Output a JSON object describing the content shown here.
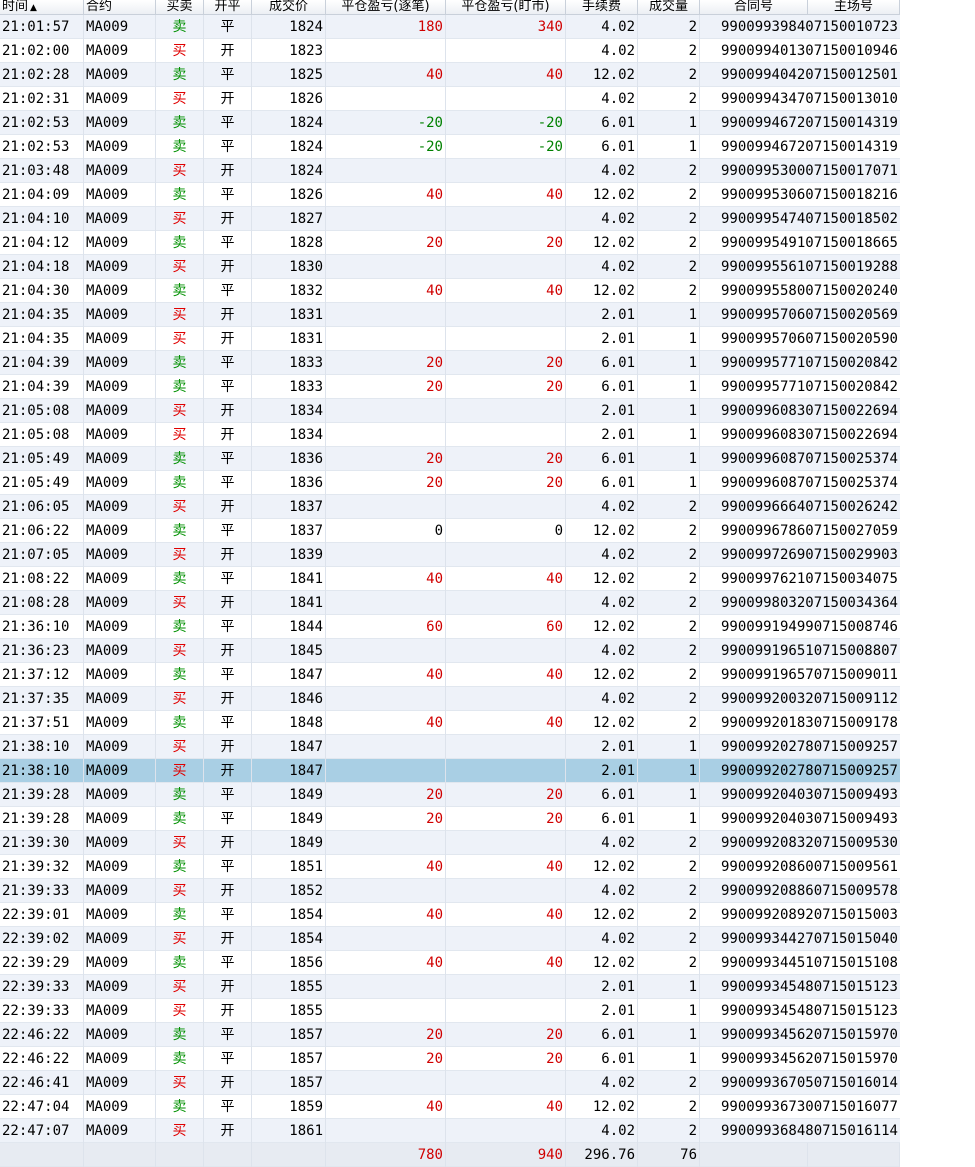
{
  "columns": {
    "time": "时间",
    "instrument": "合约",
    "side": "买卖",
    "open_close": "开平",
    "price": "成交价",
    "pnl_trade": "平仓盈亏(逐笔)",
    "pnl_mark": "平仓盈亏(盯市)",
    "fee": "手续费",
    "qty": "成交量",
    "contract_no": "合同号",
    "main_no": "主场号"
  },
  "sort_icon": "▲",
  "selected_index": 31,
  "rows": [
    {
      "time": "21:01:57",
      "inst": "MA009",
      "side": "卖",
      "oc": "平",
      "price": "1824",
      "pnl1": "180",
      "pnl2": "340",
      "fee": "4.02",
      "qty": "2",
      "cid": "990099398407150010723"
    },
    {
      "time": "21:02:00",
      "inst": "MA009",
      "side": "买",
      "oc": "开",
      "price": "1823",
      "pnl1": "",
      "pnl2": "",
      "fee": "4.02",
      "qty": "2",
      "cid": "990099401307150010946"
    },
    {
      "time": "21:02:28",
      "inst": "MA009",
      "side": "卖",
      "oc": "平",
      "price": "1825",
      "pnl1": "40",
      "pnl2": "40",
      "fee": "12.02",
      "qty": "2",
      "cid": "990099404207150012501"
    },
    {
      "time": "21:02:31",
      "inst": "MA009",
      "side": "买",
      "oc": "开",
      "price": "1826",
      "pnl1": "",
      "pnl2": "",
      "fee": "4.02",
      "qty": "2",
      "cid": "990099434707150013010"
    },
    {
      "time": "21:02:53",
      "inst": "MA009",
      "side": "卖",
      "oc": "平",
      "price": "1824",
      "pnl1": "-20",
      "pnl2": "-20",
      "fee": "6.01",
      "qty": "1",
      "cid": "990099467207150014319"
    },
    {
      "time": "21:02:53",
      "inst": "MA009",
      "side": "卖",
      "oc": "平",
      "price": "1824",
      "pnl1": "-20",
      "pnl2": "-20",
      "fee": "6.01",
      "qty": "1",
      "cid": "990099467207150014319"
    },
    {
      "time": "21:03:48",
      "inst": "MA009",
      "side": "买",
      "oc": "开",
      "price": "1824",
      "pnl1": "",
      "pnl2": "",
      "fee": "4.02",
      "qty": "2",
      "cid": "990099530007150017071"
    },
    {
      "time": "21:04:09",
      "inst": "MA009",
      "side": "卖",
      "oc": "平",
      "price": "1826",
      "pnl1": "40",
      "pnl2": "40",
      "fee": "12.02",
      "qty": "2",
      "cid": "990099530607150018216"
    },
    {
      "time": "21:04:10",
      "inst": "MA009",
      "side": "买",
      "oc": "开",
      "price": "1827",
      "pnl1": "",
      "pnl2": "",
      "fee": "4.02",
      "qty": "2",
      "cid": "990099547407150018502"
    },
    {
      "time": "21:04:12",
      "inst": "MA009",
      "side": "卖",
      "oc": "平",
      "price": "1828",
      "pnl1": "20",
      "pnl2": "20",
      "fee": "12.02",
      "qty": "2",
      "cid": "990099549107150018665"
    },
    {
      "time": "21:04:18",
      "inst": "MA009",
      "side": "买",
      "oc": "开",
      "price": "1830",
      "pnl1": "",
      "pnl2": "",
      "fee": "4.02",
      "qty": "2",
      "cid": "990099556107150019288"
    },
    {
      "time": "21:04:30",
      "inst": "MA009",
      "side": "卖",
      "oc": "平",
      "price": "1832",
      "pnl1": "40",
      "pnl2": "40",
      "fee": "12.02",
      "qty": "2",
      "cid": "990099558007150020240"
    },
    {
      "time": "21:04:35",
      "inst": "MA009",
      "side": "买",
      "oc": "开",
      "price": "1831",
      "pnl1": "",
      "pnl2": "",
      "fee": "2.01",
      "qty": "1",
      "cid": "990099570607150020569"
    },
    {
      "time": "21:04:35",
      "inst": "MA009",
      "side": "买",
      "oc": "开",
      "price": "1831",
      "pnl1": "",
      "pnl2": "",
      "fee": "2.01",
      "qty": "1",
      "cid": "990099570607150020590"
    },
    {
      "time": "21:04:39",
      "inst": "MA009",
      "side": "卖",
      "oc": "平",
      "price": "1833",
      "pnl1": "20",
      "pnl2": "20",
      "fee": "6.01",
      "qty": "1",
      "cid": "990099577107150020842"
    },
    {
      "time": "21:04:39",
      "inst": "MA009",
      "side": "卖",
      "oc": "平",
      "price": "1833",
      "pnl1": "20",
      "pnl2": "20",
      "fee": "6.01",
      "qty": "1",
      "cid": "990099577107150020842"
    },
    {
      "time": "21:05:08",
      "inst": "MA009",
      "side": "买",
      "oc": "开",
      "price": "1834",
      "pnl1": "",
      "pnl2": "",
      "fee": "2.01",
      "qty": "1",
      "cid": "990099608307150022694"
    },
    {
      "time": "21:05:08",
      "inst": "MA009",
      "side": "买",
      "oc": "开",
      "price": "1834",
      "pnl1": "",
      "pnl2": "",
      "fee": "2.01",
      "qty": "1",
      "cid": "990099608307150022694"
    },
    {
      "time": "21:05:49",
      "inst": "MA009",
      "side": "卖",
      "oc": "平",
      "price": "1836",
      "pnl1": "20",
      "pnl2": "20",
      "fee": "6.01",
      "qty": "1",
      "cid": "990099608707150025374"
    },
    {
      "time": "21:05:49",
      "inst": "MA009",
      "side": "卖",
      "oc": "平",
      "price": "1836",
      "pnl1": "20",
      "pnl2": "20",
      "fee": "6.01",
      "qty": "1",
      "cid": "990099608707150025374"
    },
    {
      "time": "21:06:05",
      "inst": "MA009",
      "side": "买",
      "oc": "开",
      "price": "1837",
      "pnl1": "",
      "pnl2": "",
      "fee": "4.02",
      "qty": "2",
      "cid": "990099666407150026242"
    },
    {
      "time": "21:06:22",
      "inst": "MA009",
      "side": "卖",
      "oc": "平",
      "price": "1837",
      "pnl1": "0",
      "pnl2": "0",
      "fee": "12.02",
      "qty": "2",
      "cid": "990099678607150027059"
    },
    {
      "time": "21:07:05",
      "inst": "MA009",
      "side": "买",
      "oc": "开",
      "price": "1839",
      "pnl1": "",
      "pnl2": "",
      "fee": "4.02",
      "qty": "2",
      "cid": "990099726907150029903"
    },
    {
      "time": "21:08:22",
      "inst": "MA009",
      "side": "卖",
      "oc": "平",
      "price": "1841",
      "pnl1": "40",
      "pnl2": "40",
      "fee": "12.02",
      "qty": "2",
      "cid": "990099762107150034075"
    },
    {
      "time": "21:08:28",
      "inst": "MA009",
      "side": "买",
      "oc": "开",
      "price": "1841",
      "pnl1": "",
      "pnl2": "",
      "fee": "4.02",
      "qty": "2",
      "cid": "990099803207150034364"
    },
    {
      "time": "21:36:10",
      "inst": "MA009",
      "side": "卖",
      "oc": "平",
      "price": "1844",
      "pnl1": "60",
      "pnl2": "60",
      "fee": "12.02",
      "qty": "2",
      "cid": "990099194990715008746"
    },
    {
      "time": "21:36:23",
      "inst": "MA009",
      "side": "买",
      "oc": "开",
      "price": "1845",
      "pnl1": "",
      "pnl2": "",
      "fee": "4.02",
      "qty": "2",
      "cid": "990099196510715008807"
    },
    {
      "time": "21:37:12",
      "inst": "MA009",
      "side": "卖",
      "oc": "平",
      "price": "1847",
      "pnl1": "40",
      "pnl2": "40",
      "fee": "12.02",
      "qty": "2",
      "cid": "990099196570715009011"
    },
    {
      "time": "21:37:35",
      "inst": "MA009",
      "side": "买",
      "oc": "开",
      "price": "1846",
      "pnl1": "",
      "pnl2": "",
      "fee": "4.02",
      "qty": "2",
      "cid": "990099200320715009112"
    },
    {
      "time": "21:37:51",
      "inst": "MA009",
      "side": "卖",
      "oc": "平",
      "price": "1848",
      "pnl1": "40",
      "pnl2": "40",
      "fee": "12.02",
      "qty": "2",
      "cid": "990099201830715009178"
    },
    {
      "time": "21:38:10",
      "inst": "MA009",
      "side": "买",
      "oc": "开",
      "price": "1847",
      "pnl1": "",
      "pnl2": "",
      "fee": "2.01",
      "qty": "1",
      "cid": "990099202780715009257"
    },
    {
      "time": "21:38:10",
      "inst": "MA009",
      "side": "买",
      "oc": "开",
      "price": "1847",
      "pnl1": "",
      "pnl2": "",
      "fee": "2.01",
      "qty": "1",
      "cid": "990099202780715009257"
    },
    {
      "time": "21:39:28",
      "inst": "MA009",
      "side": "卖",
      "oc": "平",
      "price": "1849",
      "pnl1": "20",
      "pnl2": "20",
      "fee": "6.01",
      "qty": "1",
      "cid": "990099204030715009493"
    },
    {
      "time": "21:39:28",
      "inst": "MA009",
      "side": "卖",
      "oc": "平",
      "price": "1849",
      "pnl1": "20",
      "pnl2": "20",
      "fee": "6.01",
      "qty": "1",
      "cid": "990099204030715009493"
    },
    {
      "time": "21:39:30",
      "inst": "MA009",
      "side": "买",
      "oc": "开",
      "price": "1849",
      "pnl1": "",
      "pnl2": "",
      "fee": "4.02",
      "qty": "2",
      "cid": "990099208320715009530"
    },
    {
      "time": "21:39:32",
      "inst": "MA009",
      "side": "卖",
      "oc": "平",
      "price": "1851",
      "pnl1": "40",
      "pnl2": "40",
      "fee": "12.02",
      "qty": "2",
      "cid": "990099208600715009561"
    },
    {
      "time": "21:39:33",
      "inst": "MA009",
      "side": "买",
      "oc": "开",
      "price": "1852",
      "pnl1": "",
      "pnl2": "",
      "fee": "4.02",
      "qty": "2",
      "cid": "990099208860715009578"
    },
    {
      "time": "22:39:01",
      "inst": "MA009",
      "side": "卖",
      "oc": "平",
      "price": "1854",
      "pnl1": "40",
      "pnl2": "40",
      "fee": "12.02",
      "qty": "2",
      "cid": "990099208920715015003"
    },
    {
      "time": "22:39:02",
      "inst": "MA009",
      "side": "买",
      "oc": "开",
      "price": "1854",
      "pnl1": "",
      "pnl2": "",
      "fee": "4.02",
      "qty": "2",
      "cid": "990099344270715015040"
    },
    {
      "time": "22:39:29",
      "inst": "MA009",
      "side": "卖",
      "oc": "平",
      "price": "1856",
      "pnl1": "40",
      "pnl2": "40",
      "fee": "12.02",
      "qty": "2",
      "cid": "990099344510715015108"
    },
    {
      "time": "22:39:33",
      "inst": "MA009",
      "side": "买",
      "oc": "开",
      "price": "1855",
      "pnl1": "",
      "pnl2": "",
      "fee": "2.01",
      "qty": "1",
      "cid": "990099345480715015123"
    },
    {
      "time": "22:39:33",
      "inst": "MA009",
      "side": "买",
      "oc": "开",
      "price": "1855",
      "pnl1": "",
      "pnl2": "",
      "fee": "2.01",
      "qty": "1",
      "cid": "990099345480715015123"
    },
    {
      "time": "22:46:22",
      "inst": "MA009",
      "side": "卖",
      "oc": "平",
      "price": "1857",
      "pnl1": "20",
      "pnl2": "20",
      "fee": "6.01",
      "qty": "1",
      "cid": "990099345620715015970"
    },
    {
      "time": "22:46:22",
      "inst": "MA009",
      "side": "卖",
      "oc": "平",
      "price": "1857",
      "pnl1": "20",
      "pnl2": "20",
      "fee": "6.01",
      "qty": "1",
      "cid": "990099345620715015970"
    },
    {
      "time": "22:46:41",
      "inst": "MA009",
      "side": "买",
      "oc": "开",
      "price": "1857",
      "pnl1": "",
      "pnl2": "",
      "fee": "4.02",
      "qty": "2",
      "cid": "990099367050715016014"
    },
    {
      "time": "22:47:04",
      "inst": "MA009",
      "side": "卖",
      "oc": "平",
      "price": "1859",
      "pnl1": "40",
      "pnl2": "40",
      "fee": "12.02",
      "qty": "2",
      "cid": "990099367300715016077"
    },
    {
      "time": "22:47:07",
      "inst": "MA009",
      "side": "买",
      "oc": "开",
      "price": "1861",
      "pnl1": "",
      "pnl2": "",
      "fee": "4.02",
      "qty": "2",
      "cid": "990099368480715016114"
    }
  ],
  "totals": {
    "pnl1": "780",
    "pnl2": "940",
    "fee": "296.76",
    "qty": "76"
  }
}
